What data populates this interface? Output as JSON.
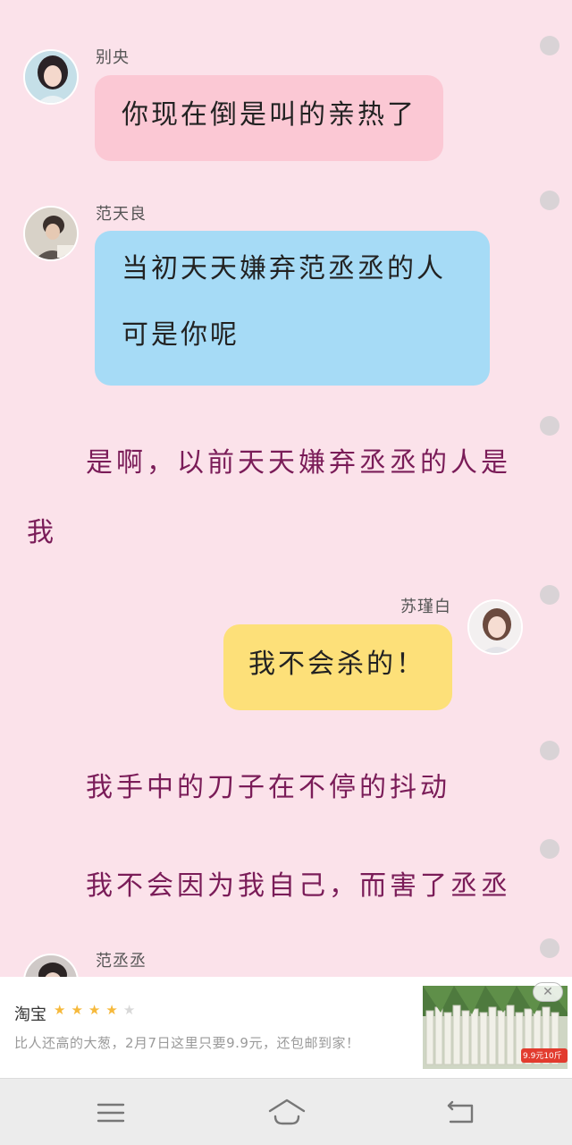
{
  "messages": [
    {
      "speaker": "别央",
      "lines": [
        "你现在倒是叫的亲热了"
      ],
      "bubble_color": "#fbc8d4"
    },
    {
      "speaker": "范天良",
      "lines": [
        "当初天天嫌弃范丞丞的人",
        "可是你呢"
      ],
      "bubble_color": "#a6dbf6"
    },
    {
      "speaker": "苏瑾白",
      "lines": [
        "我不会杀的！"
      ],
      "bubble_color": "#fde079"
    },
    {
      "speaker": "范丞丞"
    }
  ],
  "narration": [
    {
      "lines": [
        "是啊，以前天天嫌弃丞丞的人是",
        "我"
      ]
    },
    {
      "lines": [
        "我手中的刀子在不停的抖动"
      ]
    },
    {
      "lines": [
        "我不会因为我自己，而害了丞丞"
      ]
    }
  ],
  "ad": {
    "title": "淘宝",
    "rating": 4,
    "max_rating": 5,
    "text": "比人还高的大葱，2月7日这里只要9.9元，还包邮到家！",
    "image_badge": "9.9元10斤",
    "close_icon": "close-icon"
  },
  "nav": {
    "icons": [
      "menu-icon",
      "home-icon",
      "back-icon"
    ]
  },
  "colors": {
    "background": "#fbe2ea",
    "narration_text": "#7a1c58",
    "star": "#f6b93b"
  }
}
